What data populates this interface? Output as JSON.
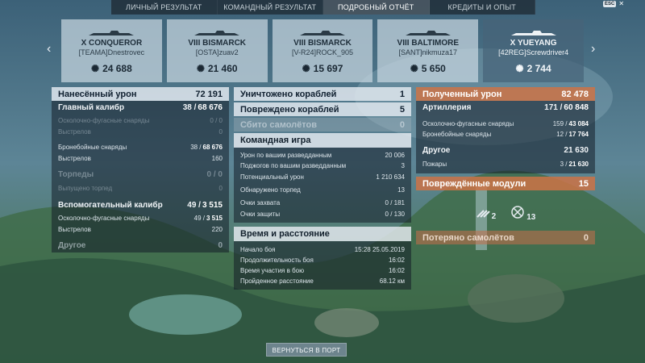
{
  "tabs": [
    "ЛИЧНЫЙ РЕЗУЛЬТАТ",
    "КОМАНДНЫЙ РЕЗУЛЬТАТ",
    "ПОДРОБНЫЙ ОТЧЁТ",
    "КРЕДИТЫ И ОПЫТ"
  ],
  "esc_label": "ESC",
  "ships": [
    {
      "name": "X CONQUEROR",
      "player": "[TEAMA]Dnestrovec",
      "damage": "24 688"
    },
    {
      "name": "VIII BISMARCK",
      "player": "[OSTA]zuav2",
      "damage": "21 460"
    },
    {
      "name": "VIII BISMARCK",
      "player": "[V-R24]ROCK_905",
      "damage": "15 697"
    },
    {
      "name": "VIII BALTIMORE",
      "player": "[SANT]nikmuza17",
      "damage": "5 650"
    },
    {
      "name": "X YUEYANG",
      "player": "[42REG]Screwdriver4",
      "damage": "2 744"
    }
  ],
  "left": {
    "damage_label": "Нанесённый урон",
    "damage_value": "72 191",
    "main_label": "Главный калибр",
    "main_a": "38 /",
    "main_b": "68 676",
    "he_label": "Осколочно-фугасные снаряды",
    "he_value": "0 / 0",
    "he_shots_label": "Выстрелов",
    "he_shots_value": "0",
    "ap_label": "Бронебойные снаряды",
    "ap_a": "38 /",
    "ap_b": "68 676",
    "ap_shots_label": "Выстрелов",
    "ap_shots_value": "160",
    "torp_label": "Торпеды",
    "torp_value": "0 / 0",
    "torp_fired_label": "Выпущено торпед",
    "torp_fired_value": "0",
    "sec_label": "Вспомогательный калибр",
    "sec_a": "49 /",
    "sec_b": "3 515",
    "sec_he_label": "Осколочно-фугасные снаряды",
    "sec_he_a": "49 /",
    "sec_he_b": "3 515",
    "sec_shots_label": "Выстрелов",
    "sec_shots_value": "220",
    "other_label": "Другое",
    "other_value": "0"
  },
  "middle": {
    "destroyed_label": "Уничтожено кораблей",
    "destroyed_value": "1",
    "damaged_label": "Повреждено кораблей",
    "damaged_value": "5",
    "planes_label": "Сбито самолётов",
    "planes_value": "0",
    "team_title": "Командная игра",
    "team_rows": [
      {
        "label": "Урон по вашим разведданным",
        "value": "20 006"
      },
      {
        "label": "Поджогов по вашим разведданным",
        "value": "3"
      },
      {
        "label": "Потенциальный урон",
        "value": "1 210 634"
      },
      {
        "label": "Обнаружено торпед",
        "value": "13"
      },
      {
        "label": "Очки захвата",
        "value": "0 / 181"
      },
      {
        "label": "Очки защиты",
        "value": "0 / 130"
      }
    ],
    "time_title": "Время и расстояние",
    "time_rows": [
      {
        "label": "Начало боя",
        "value": "15:28  25.05.2019"
      },
      {
        "label": "Продолжительность боя",
        "value": "16:02"
      },
      {
        "label": "Время участия в бою",
        "value": "16:02"
      },
      {
        "label": "Пройденное расстояние",
        "value": "68.12 км"
      }
    ]
  },
  "right": {
    "received_label": "Полученный урон",
    "received_value": "82 478",
    "art_label": "Артиллерия",
    "art_a": "171 /",
    "art_b": "60 848",
    "he_label": "Осколочно-фугасные снаряды",
    "he_a": "159 /",
    "he_b": "43 084",
    "ap_label": "Бронебойные снаряды",
    "ap_a": "12 /",
    "ap_b": "17 764",
    "other_label": "Другое",
    "other_value": "21 630",
    "fires_label": "Пожары",
    "fires_a": "3 /",
    "fires_b": "21 630",
    "modules_label": "Повреждённые модули",
    "modules_value": "15",
    "module_counts": [
      "2",
      "13"
    ],
    "lost_planes_label": "Потеряно самолётов",
    "lost_planes_value": "0"
  },
  "return_button": "ВЕРНУТЬСЯ В ПОРТ"
}
